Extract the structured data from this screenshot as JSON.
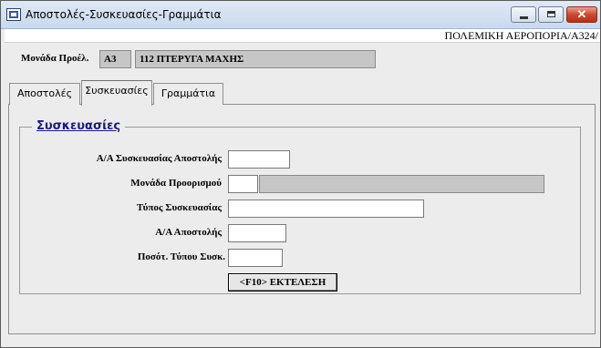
{
  "window": {
    "title": "Αποστολές-Συσκευασίες-Γραμμάτια",
    "close_glyph": "✕"
  },
  "header": {
    "organization": "ΠΟΛΕΜΙΚΗ ΑΕΡΟΠΟΡΙΑ/Α324/"
  },
  "unit": {
    "label": "Μονάδα Προέλ.",
    "code": "Α3",
    "name": "112 ΠΤΕΡΥΓΑ ΜΑΧΗΣ"
  },
  "tabs": [
    {
      "label": "Αποστολές",
      "active": false
    },
    {
      "label": "Συσκευασίες",
      "active": true
    },
    {
      "label": "Γραμμάτια",
      "active": false
    }
  ],
  "packaging": {
    "section_title": "Συσκευασίες",
    "fields": [
      {
        "label": "Α/Α Συσκευασίας Αποστολής",
        "value": ""
      },
      {
        "label": "Μονάδα Προορισμού",
        "value": "",
        "description": ""
      },
      {
        "label": "Τύπος Συσκευασίας",
        "value": ""
      },
      {
        "label": "Α/Α Αποστολής",
        "value": ""
      },
      {
        "label": "Ποσότ. Τύπου Συσκ.",
        "value": ""
      }
    ],
    "execute_label": "<F10> ΕΚΤΕΛΕΣΗ"
  }
}
